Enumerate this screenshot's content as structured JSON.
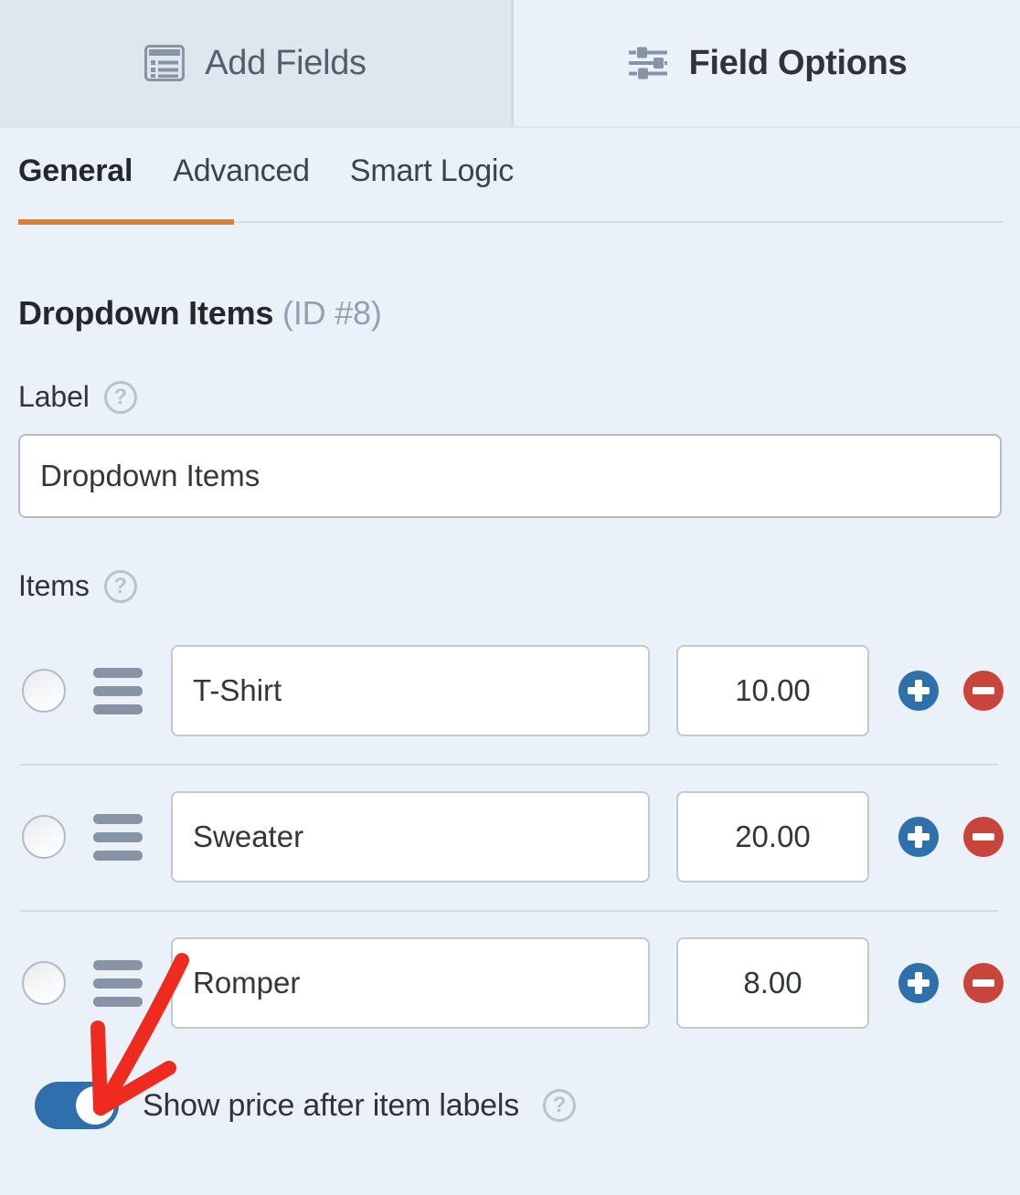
{
  "top_tabs": [
    {
      "label": "Add Fields",
      "icon": "form-list-icon",
      "active": false
    },
    {
      "label": "Field Options",
      "icon": "sliders-icon",
      "active": true
    }
  ],
  "sub_tabs": [
    {
      "label": "General",
      "active": true
    },
    {
      "label": "Advanced",
      "active": false
    },
    {
      "label": "Smart Logic",
      "active": false
    }
  ],
  "field": {
    "title": "Dropdown Items",
    "id_text": "(ID #8)",
    "label_heading": "Label",
    "label_help_icon": "help-icon",
    "label_value": "Dropdown Items",
    "items_heading": "Items",
    "items_help_icon": "help-icon"
  },
  "items": [
    {
      "name": "T-Shirt",
      "price": "10.00",
      "selected": false
    },
    {
      "name": "Sweater",
      "price": "20.00",
      "selected": false
    },
    {
      "name": "Romper",
      "price": "8.00",
      "selected": false
    }
  ],
  "row_buttons": {
    "add_icon": "plus-circle-icon",
    "remove_icon": "minus-circle-icon"
  },
  "show_price_toggle": {
    "label": "Show price after item labels",
    "enabled": true,
    "help_icon": "help-icon"
  },
  "colors": {
    "page_background": "#eaf1f9",
    "inactive_tab_background": "#e0e6ed",
    "active_underline": "#d8803e",
    "toggle_on": "#2f6fab",
    "add_button": "#2f6fab",
    "remove_button": "#c8453c",
    "annotation_arrow": "#ef2b20",
    "muted_text": "#93a1b2",
    "icon_gray": "#8694a5"
  },
  "annotation": {
    "type": "arrow",
    "points_to": "show-price-toggle"
  }
}
